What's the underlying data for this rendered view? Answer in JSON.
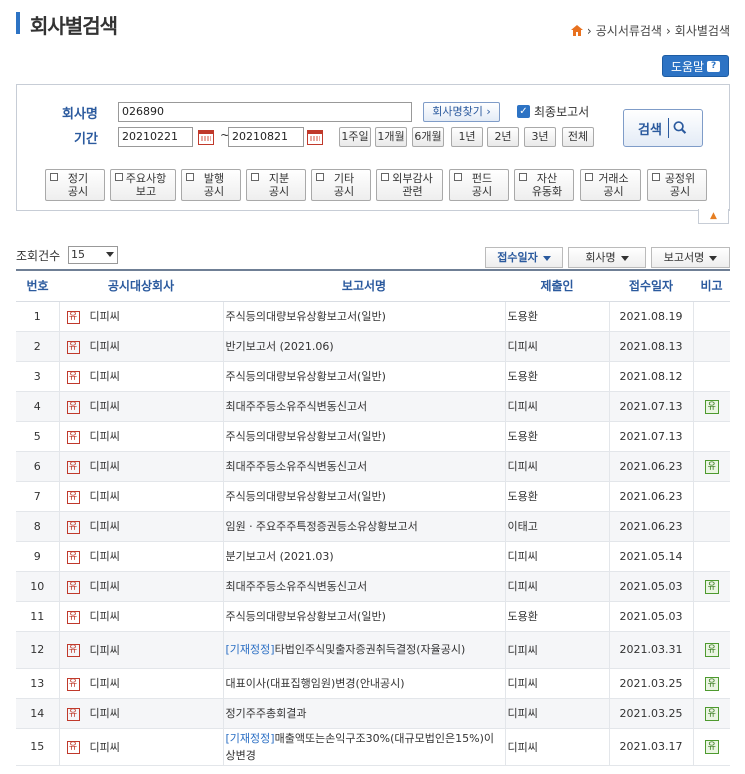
{
  "header": {
    "title": "회사별검색",
    "breadcrumb": [
      "공시서류검색",
      "회사별검색"
    ],
    "help_label": "도움말"
  },
  "search": {
    "company_label": "회사명",
    "company_value": "026890",
    "find_company_label": "회사명찾기 ›",
    "final_report_label": "최종보고서",
    "final_report_checked": true,
    "period_label": "기간",
    "date_from": "20210221",
    "date_to": "20210821",
    "period_buttons": [
      "1주일",
      "1개월",
      "6개월",
      "1년",
      "2년",
      "3년",
      "전체"
    ],
    "search_label": "검색",
    "categories": [
      [
        "정기",
        "공시"
      ],
      [
        "주요사항",
        "보고"
      ],
      [
        "발행",
        "공시"
      ],
      [
        "지분",
        "공시"
      ],
      [
        "기타",
        "공시"
      ],
      [
        "외부감사",
        "관련"
      ],
      [
        "펀드",
        "공시"
      ],
      [
        "자산",
        "유동화"
      ],
      [
        "거래소",
        "공시"
      ],
      [
        "공정위",
        "공시"
      ]
    ]
  },
  "list_controls": {
    "count_label": "조회건수",
    "count_value": "15",
    "sort_buttons": [
      "접수일자",
      "회사명",
      "보고서명"
    ]
  },
  "table": {
    "columns": [
      "번호",
      "공시대상회사",
      "보고서명",
      "제출인",
      "접수일자",
      "비고"
    ],
    "market_mark": "유",
    "rows": [
      {
        "no": "1",
        "company": "디피씨",
        "prefix": "",
        "report": "주식등의대량보유상황보고서(일반)",
        "filer": "도용환",
        "date": "2021.08.19",
        "note": ""
      },
      {
        "no": "2",
        "company": "디피씨",
        "prefix": "",
        "report": "반기보고서 (2021.06)",
        "filer": "디피씨",
        "date": "2021.08.13",
        "note": ""
      },
      {
        "no": "3",
        "company": "디피씨",
        "prefix": "",
        "report": "주식등의대량보유상황보고서(일반)",
        "filer": "도용환",
        "date": "2021.08.12",
        "note": ""
      },
      {
        "no": "4",
        "company": "디피씨",
        "prefix": "",
        "report": "최대주주등소유주식변동신고서",
        "filer": "디피씨",
        "date": "2021.07.13",
        "note": "유"
      },
      {
        "no": "5",
        "company": "디피씨",
        "prefix": "",
        "report": "주식등의대량보유상황보고서(일반)",
        "filer": "도용환",
        "date": "2021.07.13",
        "note": ""
      },
      {
        "no": "6",
        "company": "디피씨",
        "prefix": "",
        "report": "최대주주등소유주식변동신고서",
        "filer": "디피씨",
        "date": "2021.06.23",
        "note": "유"
      },
      {
        "no": "7",
        "company": "디피씨",
        "prefix": "",
        "report": "주식등의대량보유상황보고서(일반)",
        "filer": "도용환",
        "date": "2021.06.23",
        "note": ""
      },
      {
        "no": "8",
        "company": "디피씨",
        "prefix": "",
        "report": "임원ㆍ주요주주특정증권등소유상황보고서",
        "filer": "이태고",
        "date": "2021.06.23",
        "note": ""
      },
      {
        "no": "9",
        "company": "디피씨",
        "prefix": "",
        "report": "분기보고서 (2021.03)",
        "filer": "디피씨",
        "date": "2021.05.14",
        "note": ""
      },
      {
        "no": "10",
        "company": "디피씨",
        "prefix": "",
        "report": "최대주주등소유주식변동신고서",
        "filer": "디피씨",
        "date": "2021.05.03",
        "note": "유"
      },
      {
        "no": "11",
        "company": "디피씨",
        "prefix": "",
        "report": "주식등의대량보유상황보고서(일반)",
        "filer": "도용환",
        "date": "2021.05.03",
        "note": ""
      },
      {
        "no": "12",
        "company": "디피씨",
        "prefix": "[기재정정]",
        "report": "타법인주식및출자증권취득결정(자율공시)",
        "filer": "디피씨",
        "date": "2021.03.31",
        "note": "유"
      },
      {
        "no": "13",
        "company": "디피씨",
        "prefix": "",
        "report": "대표이사(대표집행임원)변경(안내공시)",
        "filer": "디피씨",
        "date": "2021.03.25",
        "note": "유"
      },
      {
        "no": "14",
        "company": "디피씨",
        "prefix": "",
        "report": "정기주주총회결과",
        "filer": "디피씨",
        "date": "2021.03.25",
        "note": "유"
      },
      {
        "no": "15",
        "company": "디피씨",
        "prefix": "[기재정정]",
        "report": "매출액또는손익구조30%(대규모법인은15%)이상변경",
        "filer": "디피씨",
        "date": "2021.03.17",
        "note": "유"
      }
    ]
  }
}
